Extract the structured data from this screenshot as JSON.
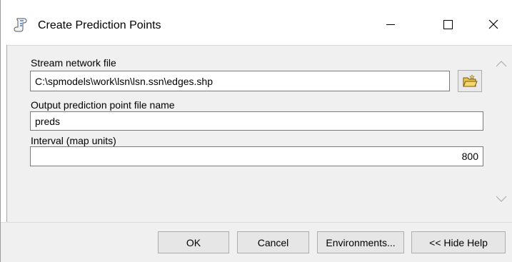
{
  "window": {
    "title": "Create Prediction Points",
    "icon": "toolbox-script-icon"
  },
  "form": {
    "stream_label": "Stream network file",
    "stream_value": "C:\\spmodels\\work\\lsn\\lsn.ssn\\edges.shp",
    "output_label": "Output prediction point file name",
    "output_value": "preds",
    "interval_label": "Interval (map units)",
    "interval_value": "800"
  },
  "buttons": {
    "ok": "OK",
    "cancel": "Cancel",
    "environments": "Environments...",
    "hide_help": "<< Hide Help"
  },
  "colors": {
    "panel": "#f0f0f0",
    "folder": "#e8c24a"
  }
}
